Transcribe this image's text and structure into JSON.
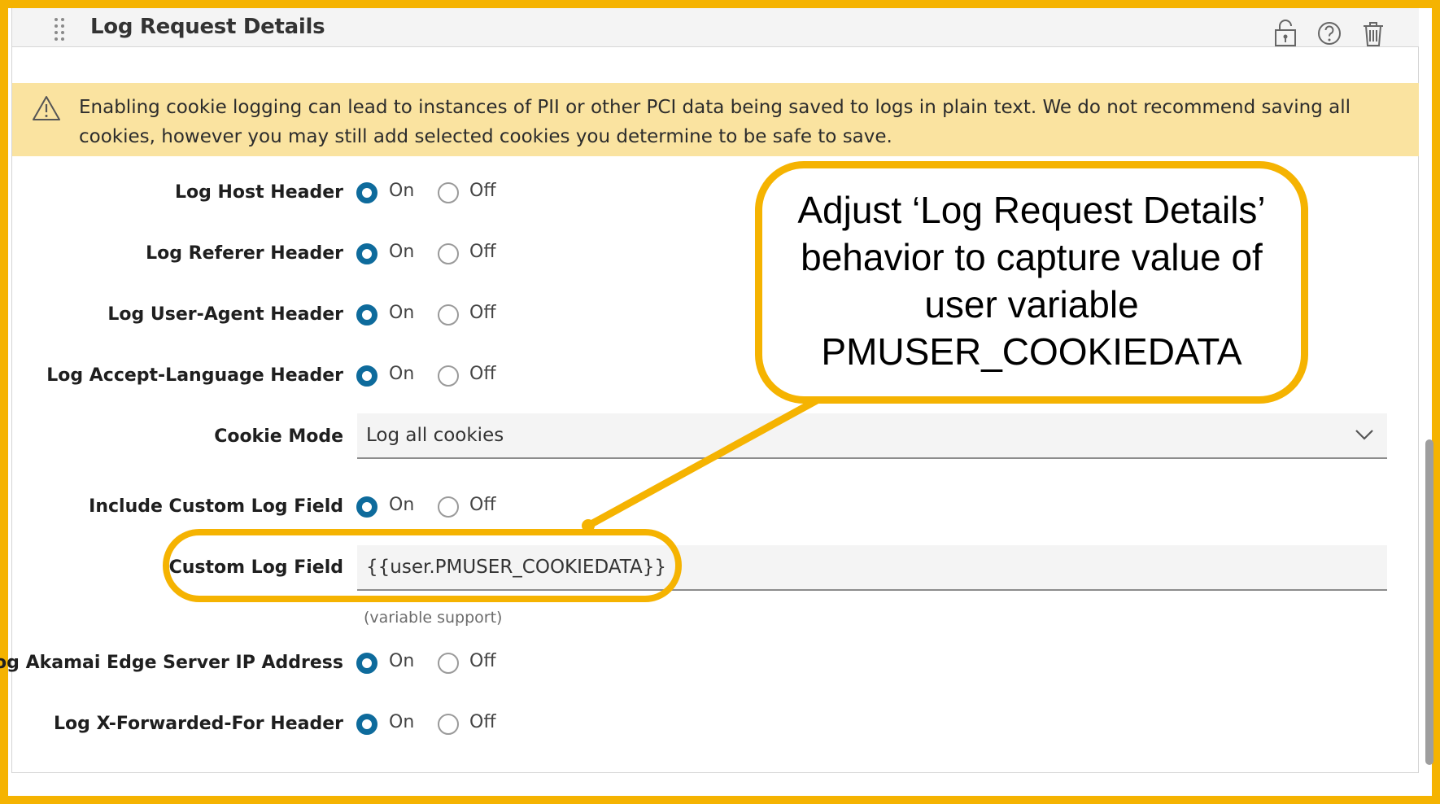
{
  "panel": {
    "title": "Log Request Details",
    "icons": [
      "lock-icon",
      "help-icon",
      "trash-icon"
    ]
  },
  "warning": {
    "icon": "warning-triangle-icon",
    "text": "Enabling cookie logging can lead to instances of PII or other PCI data being saved to logs in plain text. We do not recommend saving all cookies, however you may still add selected cookies you determine to be safe to save."
  },
  "radio_options": {
    "on": "On",
    "off": "Off"
  },
  "settings": {
    "host_header": {
      "label": "Log Host Header",
      "value": "On"
    },
    "referer_header": {
      "label": "Log Referer Header",
      "value": "On"
    },
    "user_agent_header": {
      "label": "Log User-Agent Header",
      "value": "On"
    },
    "accept_language_header": {
      "label": "Log Accept-Language Header",
      "value": "On"
    },
    "cookie_mode": {
      "label": "Cookie Mode",
      "value": "Log all cookies"
    },
    "include_custom_log_field": {
      "label": "Include Custom Log Field",
      "value": "On"
    },
    "custom_log_field": {
      "label": "Custom Log Field",
      "value": "{{user.PMUSER_COOKIEDATA}}",
      "help": "(variable support)"
    },
    "edge_server_ip": {
      "label": "Log Akamai Edge Server IP Address",
      "value": "On"
    },
    "x_forwarded_for": {
      "label": "Log X-Forwarded-For Header",
      "value": "On"
    }
  },
  "annotation": {
    "text": "Adjust ‘Log Request Details’ behavior to capture value of user variable PMUSER_COOKIEDATA",
    "color": "#f5b301"
  },
  "colors": {
    "accent": "#0e6b9c",
    "warning_bg": "#fae3a0",
    "annotation": "#f5b301"
  }
}
